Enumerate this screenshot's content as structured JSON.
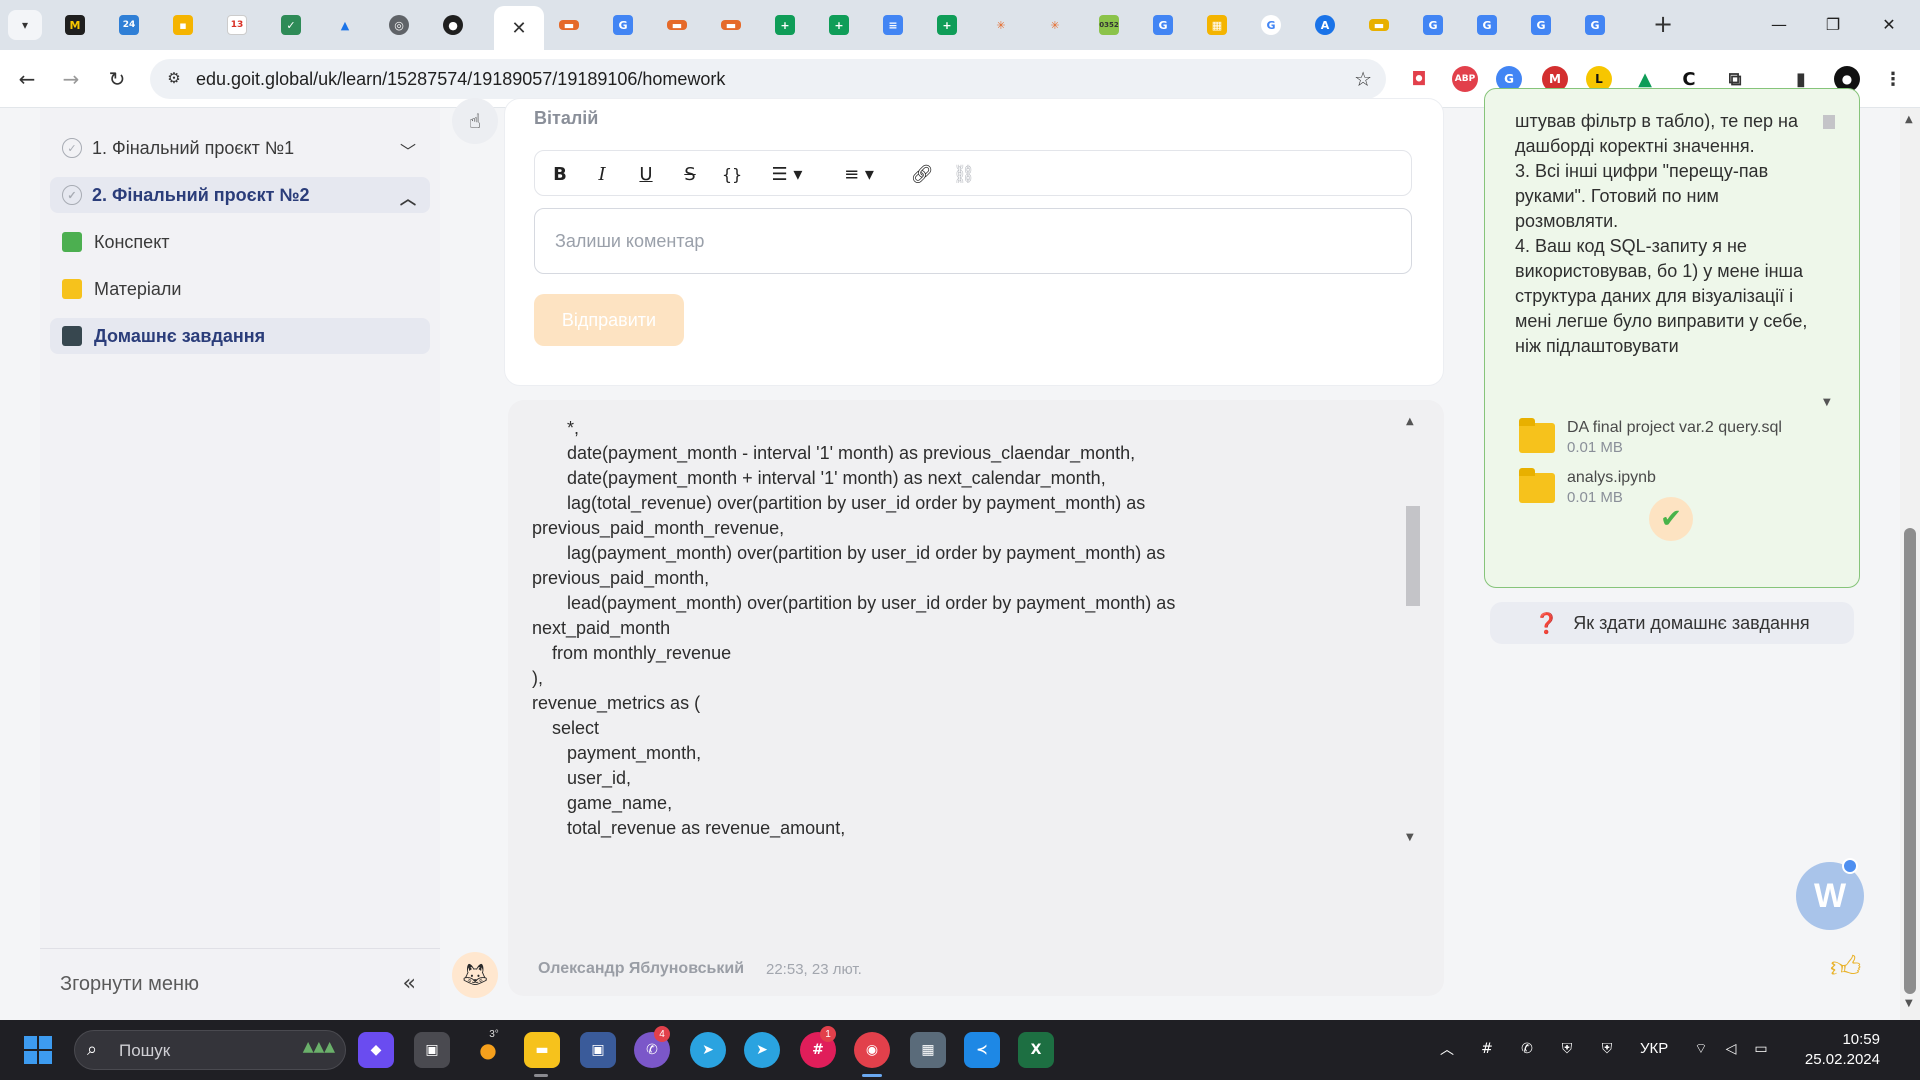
{
  "browser": {
    "url": "edu.goit.global/uk/learn/15287574/19189057/19189106/homework",
    "active_tab_close": "✕",
    "new_tab": "+",
    "favicon_labels": [
      "24",
      "13",
      "0352"
    ]
  },
  "sidebar": {
    "items": [
      {
        "label": "1. Фінальний проєкт №1",
        "state": "collapsed"
      },
      {
        "label": "2. Фінальний проєкт №2",
        "state": "expanded"
      },
      {
        "label": "Конспект"
      },
      {
        "label": "Матеріали"
      },
      {
        "label": "Домашнє завдання"
      }
    ],
    "collapse_label": "Згорнути меню"
  },
  "comment_form": {
    "author": "Віталій",
    "placeholder": "Залиши коментар",
    "send_label": "Відправити",
    "toolbar": [
      "B",
      "I",
      "U",
      "S",
      "{}",
      "list",
      "align",
      "link",
      "unlink"
    ]
  },
  "message": {
    "code": "       *,\n       date(payment_month - interval '1' month) as previous_claendar_month,\n       date(payment_month + interval '1' month) as next_calendar_month,\n       lag(total_revenue) over(partition by user_id order by payment_month) as\nprevious_paid_month_revenue,\n       lag(payment_month) over(partition by user_id order by payment_month) as\nprevious_paid_month,\n       lead(payment_month) over(partition by user_id order by payment_month) as\nnext_paid_month\n    from monthly_revenue\n),\nrevenue_metrics as (\n    select\n       payment_month,\n       user_id,\n       game_name,\n       total_revenue as revenue_amount,\n       'revenue' as revenue_type\n    from revenue_lag_lead_months\n\n    union all",
    "author": "Олександр Яблуновський",
    "time": "22:53, 23 лют."
  },
  "homework_panel": {
    "text": "штував фільтр в табло), те пер на дашборді коректні значення.\n3. Всі інші цифри \"перещу-пав руками\". Готовий по ним розмовляти.\n4. Ваш код SQL-запиту я не використовував, бо 1) у мене інша структура даних для візуалізації і мені легше було виправити у себе, ніж підлаштовувати",
    "files": [
      {
        "name": "DA final project var.2 query.sql",
        "size": "0.01 MB"
      },
      {
        "name": "analys.ipynb",
        "size": "0.01 MB"
      }
    ],
    "help_label": "Як здати домашнє завдання",
    "help_icon": "❓"
  },
  "widget": {
    "letter": "W"
  },
  "taskbar": {
    "search_placeholder": "Пошук",
    "badges": [
      "4",
      "1"
    ],
    "weather": "3°",
    "lang": "УКР",
    "time": "10:59",
    "date": "25.02.2024"
  },
  "colors": {
    "accent": "#2b3d7a",
    "send_disabled": "#fde3c2",
    "panel_border": "#86c47a",
    "approve": "#49b34a"
  }
}
